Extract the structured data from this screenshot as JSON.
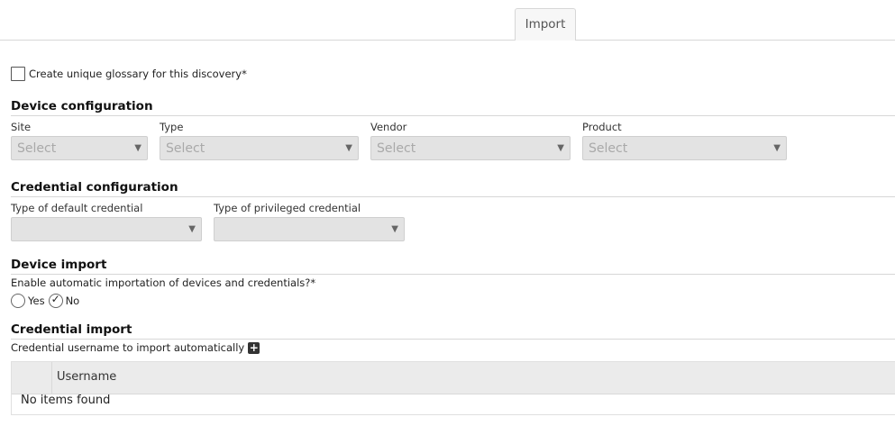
{
  "tabs": [
    {
      "label": "Import"
    }
  ],
  "glossary": {
    "label": "Create unique glossary for this discovery*",
    "checked": false
  },
  "device_config": {
    "title": "Device configuration",
    "fields": [
      {
        "label": "Site",
        "value": "Select"
      },
      {
        "label": "Type",
        "value": "Select"
      },
      {
        "label": "Vendor",
        "value": "Select"
      },
      {
        "label": "Product",
        "value": "Select"
      }
    ]
  },
  "credential_config": {
    "title": "Credential configuration",
    "fields": [
      {
        "label": "Type of default credential",
        "value": ""
      },
      {
        "label": "Type of privileged credential",
        "value": ""
      }
    ]
  },
  "device_import": {
    "title": "Device import",
    "question": "Enable automatic importation of devices and credentials?*",
    "options": [
      {
        "label": "Yes",
        "checked": false
      },
      {
        "label": "No",
        "checked": true
      }
    ]
  },
  "credential_import": {
    "title": "Credential import",
    "username_label": "Credential username to import automatically",
    "add_icon": "plus-icon",
    "table": {
      "columns": [
        "Username"
      ],
      "empty_text": "No items found"
    }
  }
}
